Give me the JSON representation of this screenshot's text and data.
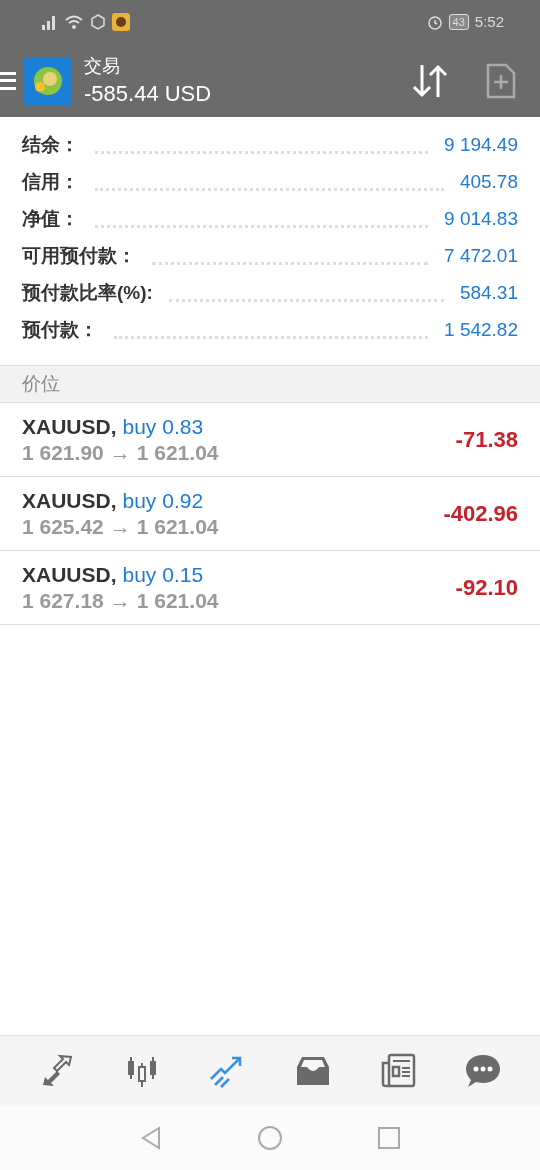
{
  "status_bar": {
    "battery": "43",
    "time": "5:52"
  },
  "header": {
    "title": "交易",
    "balance": "-585.44 USD"
  },
  "summary": [
    {
      "label": "结余：",
      "value": "9 194.49"
    },
    {
      "label": "信用：",
      "value": "405.78"
    },
    {
      "label": "净值：",
      "value": "9 014.83"
    },
    {
      "label": "可用预付款：",
      "value": "7 472.01"
    },
    {
      "label": "预付款比率(%):",
      "value": "584.31"
    },
    {
      "label": "预付款：",
      "value": "1 542.82"
    }
  ],
  "section_title": "价位",
  "positions": [
    {
      "symbol": "XAUUSD,",
      "order": "buy 0.83",
      "open_price": "1 621.90",
      "arrow": "→",
      "current_price": "1 621.04",
      "profit": "-71.38"
    },
    {
      "symbol": "XAUUSD,",
      "order": "buy 0.92",
      "open_price": "1 625.42",
      "arrow": "→",
      "current_price": "1 621.04",
      "profit": "-402.96"
    },
    {
      "symbol": "XAUUSD,",
      "order": "buy 0.15",
      "open_price": "1 627.18",
      "arrow": "→",
      "current_price": "1 621.04",
      "profit": "-92.10"
    }
  ],
  "bottom_nav": [
    {
      "kind": "quotes",
      "selected": false
    },
    {
      "kind": "chart",
      "selected": false
    },
    {
      "kind": "trade",
      "selected": true
    },
    {
      "kind": "history",
      "selected": false
    },
    {
      "kind": "news",
      "selected": false
    },
    {
      "kind": "chat",
      "selected": false
    }
  ]
}
